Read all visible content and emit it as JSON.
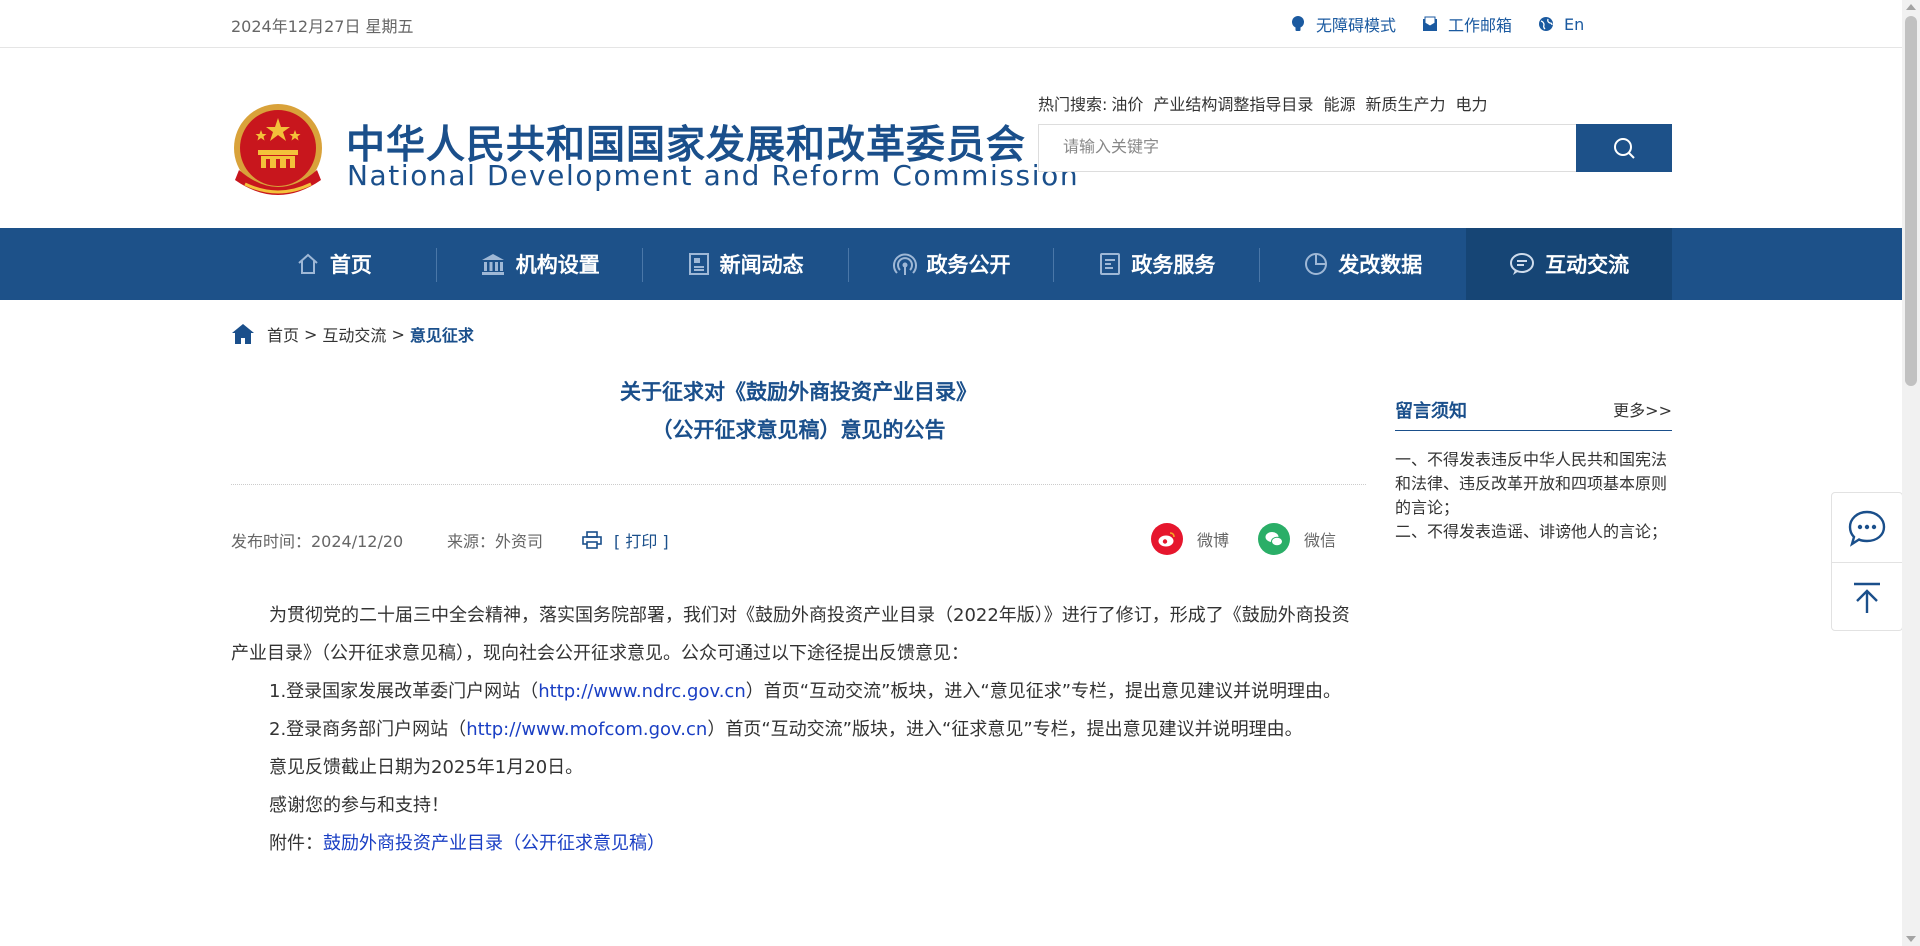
{
  "topbar": {
    "date": "2024年12月27日 星期五",
    "accessibility": "无障碍模式",
    "mailbox": "工作邮箱",
    "english": "En"
  },
  "header": {
    "title_cn": "中华人民共和国国家发展和改革委员会",
    "title_en": "National Development and Reform Commission",
    "hot_label": "热门搜索:",
    "hot_items": [
      "油价",
      "产业结构调整指导目录",
      "能源",
      "新质生产力",
      "电力"
    ],
    "search_placeholder": "请输入关键字"
  },
  "nav": {
    "items": [
      {
        "label": "首页",
        "icon": "home-icon"
      },
      {
        "label": "机构设置",
        "icon": "building-icon"
      },
      {
        "label": "新闻动态",
        "icon": "news-icon"
      },
      {
        "label": "政务公开",
        "icon": "broadcast-icon"
      },
      {
        "label": "政务服务",
        "icon": "document-icon"
      },
      {
        "label": "发改数据",
        "icon": "pie-chart-icon"
      },
      {
        "label": "互动交流",
        "icon": "chat-icon"
      }
    ],
    "active": "互动交流"
  },
  "breadcrumb": {
    "home": "首页",
    "sep": ">",
    "section": "互动交流",
    "current": "意见征求"
  },
  "article": {
    "title_line1": "关于征求对《鼓励外商投资产业目录》",
    "title_line2": "（公开征求意见稿）意见的公告",
    "publish_time": "发布时间：2024/12/20",
    "source": "来源：外资司",
    "print": "[ 打印 ]",
    "share_weibo": "微博",
    "share_weixin": "微信",
    "para1": "为贯彻党的二十届三中全会精神，落实国务院部署，我们对《鼓励外商投资产业目录（2022年版）》进行了修订，形成了《鼓励外商投资产业目录》（公开征求意见稿），现向社会公开征求意见。公众可通过以下途径提出反馈意见：",
    "item1_pre": "1.登录国家发展改革委门户网站（",
    "item1_link": "http://www.ndrc.gov.cn",
    "item1_post": "）首页“互动交流”板块，进入“意见征求”专栏，提出意见建议并说明理由。",
    "item2_pre": "2.登录商务部门户网站（",
    "item2_link": "http://www.mofcom.gov.cn",
    "item2_post": "）首页“互动交流”版块，进入“征求意见”专栏，提出意见建议并说明理由。",
    "deadline": "意见反馈截止日期为2025年1月20日。",
    "thanks": "感谢您的参与和支持！",
    "attach_label": "附件：",
    "attach_link": "鼓励外商投资产业目录（公开征求意见稿）"
  },
  "sidebar": {
    "heading": "留言须知",
    "more": "更多>>",
    "rule1": "一、不得发表违反中华人民共和国宪法和法律、违反改革开放和四项基本原则的言论；",
    "rule2": "二、不得发表造谣、诽谤他人的言论；"
  },
  "colors": {
    "brand_blue": "#1d5189",
    "nav_active": "#164575",
    "title_blue": "#1a4f8b",
    "link_blue": "#1a3fc4",
    "weibo_red": "#e6162d",
    "wechat_green": "#2aae67"
  }
}
